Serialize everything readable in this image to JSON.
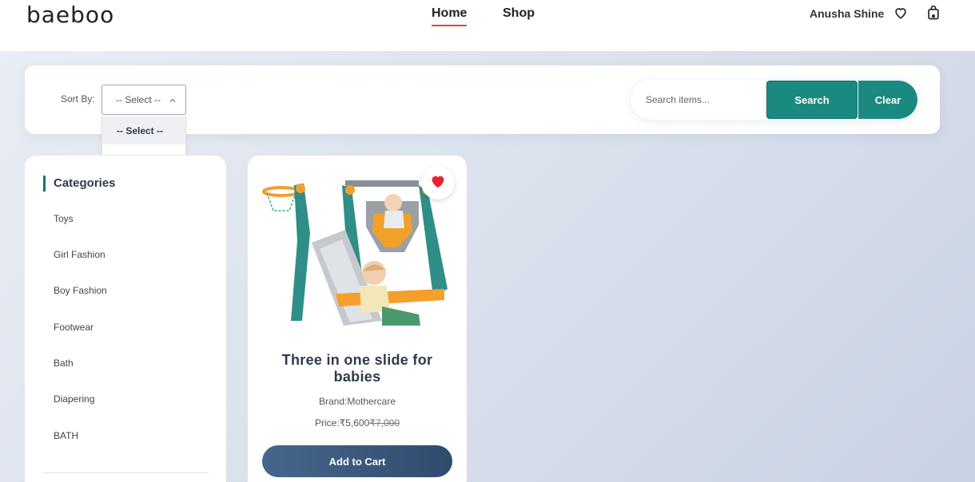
{
  "header": {
    "logo": "baeboo",
    "nav": {
      "home": "Home",
      "shop": "Shop"
    },
    "user_name": "Anusha Shine",
    "icons": {
      "wishlist": "heart-icon",
      "cart": "shopping-bag-icon"
    },
    "active_underline_color": "#e0454a"
  },
  "filters": {
    "sort_label": "Sort By:",
    "sort_value": "-- Select --",
    "sort_options": [
      "-- Select --"
    ],
    "search_placeholder": "Search items...",
    "search_button": "Search",
    "clear_button": "Clear",
    "accent_color": "#1a8a80"
  },
  "sidebar": {
    "title": "Categories",
    "items": [
      "Toys",
      "Girl Fashion",
      "Boy Fashion",
      "Footwear",
      "Bath",
      "Diapering",
      "BATH"
    ]
  },
  "products": [
    {
      "title": "Three in one slide for babies",
      "brand": "Brand:Mothercare",
      "price_label": "Price:",
      "price": "₹5,600",
      "old_price": "₹7,000",
      "add_to_cart": "Add to Cart",
      "favorite": true,
      "favorite_icon": "heart-filled-icon"
    }
  ]
}
